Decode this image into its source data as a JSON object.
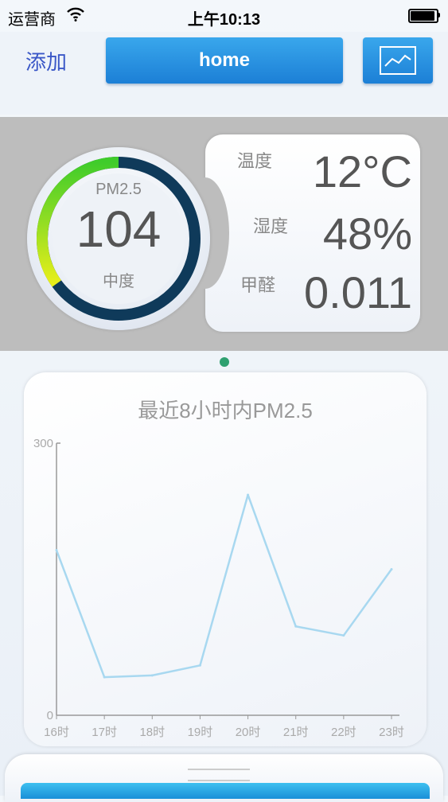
{
  "status_bar": {
    "carrier": "运营商",
    "time": "上午10:13"
  },
  "nav": {
    "add_label": "添加",
    "title": "home",
    "chart_icon": "line-chart-icon"
  },
  "sensors": {
    "pm_label": "PM2.5",
    "pm_value": "104",
    "pm_level": "中度",
    "pm_gauge_fraction": 0.35,
    "readings": [
      {
        "label": "温度",
        "value": "12°C"
      },
      {
        "label": "湿度",
        "value": "48%"
      },
      {
        "label": "甲醛",
        "value": "0.011"
      }
    ]
  },
  "pager": {
    "active_index": 0
  },
  "chart_data": {
    "type": "line",
    "title": "最近8小时内PM2.5",
    "categories": [
      "16时",
      "17时",
      "18时",
      "19时",
      "20时",
      "21时",
      "22时",
      "23时"
    ],
    "values": [
      182,
      42,
      44,
      55,
      243,
      98,
      88,
      161
    ],
    "ylim": [
      0,
      300
    ],
    "yticks": [
      "0",
      "300"
    ],
    "line_color": "#a8d8f0",
    "grid": false
  }
}
